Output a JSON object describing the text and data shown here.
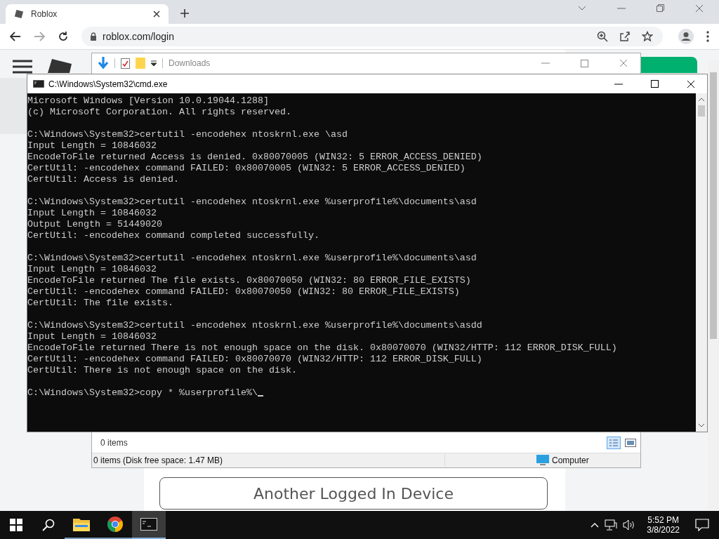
{
  "browser": {
    "tab": {
      "title": "Roblox",
      "selected": true
    },
    "address": "roblox.com/login"
  },
  "page": {
    "device_button": "Another Logged In Device"
  },
  "explorer": {
    "title": "Downloads",
    "items_count": "0 items",
    "status": "0 items (Disk free space: 1.47 MB)",
    "location": "Computer"
  },
  "cmd": {
    "title": "C:\\Windows\\System32\\cmd.exe",
    "blocks": [
      [
        "Microsoft Windows [Version 10.0.19044.1288]",
        "(c) Microsoft Corporation. All rights reserved."
      ],
      [
        "C:\\Windows\\System32>certutil -encodehex ntoskrnl.exe \\asd",
        "Input Length = 10846032",
        "EncodeToFile returned Access is denied. 0x80070005 (WIN32: 5 ERROR_ACCESS_DENIED)",
        "CertUtil: -encodehex command FAILED: 0x80070005 (WIN32: 5 ERROR_ACCESS_DENIED)",
        "CertUtil: Access is denied."
      ],
      [
        "C:\\Windows\\System32>certutil -encodehex ntoskrnl.exe %userprofile%\\documents\\asd",
        "Input Length = 10846032",
        "Output Length = 51449020",
        "CertUtil: -encodehex command completed successfully."
      ],
      [
        "C:\\Windows\\System32>certutil -encodehex ntoskrnl.exe %userprofile%\\documents\\asd",
        "Input Length = 10846032",
        "EncodeToFile returned The file exists. 0x80070050 (WIN32: 80 ERROR_FILE_EXISTS)",
        "CertUtil: -encodehex command FAILED: 0x80070050 (WIN32: 80 ERROR_FILE_EXISTS)",
        "CertUtil: The file exists."
      ],
      [
        "C:\\Windows\\System32>certutil -encodehex ntoskrnl.exe %userprofile%\\documents\\asdd",
        "Input Length = 10846032",
        "EncodeToFile returned There is not enough space on the disk. 0x80070070 (WIN32/HTTP: 112 ERROR_DISK_FULL)",
        "CertUtil: -encodehex command FAILED: 0x80070070 (WIN32/HTTP: 112 ERROR_DISK_FULL)",
        "CertUtil: There is not enough space on the disk."
      ],
      [
        "C:\\Windows\\System32>copy * %userprofile%\\"
      ]
    ]
  },
  "taskbar": {
    "time": "5:52 PM",
    "date": "3/8/2022",
    "apps": [
      {
        "kind": "explorer",
        "selected": false
      },
      {
        "kind": "chrome",
        "selected": false
      },
      {
        "kind": "cmd",
        "selected": true
      }
    ]
  }
}
